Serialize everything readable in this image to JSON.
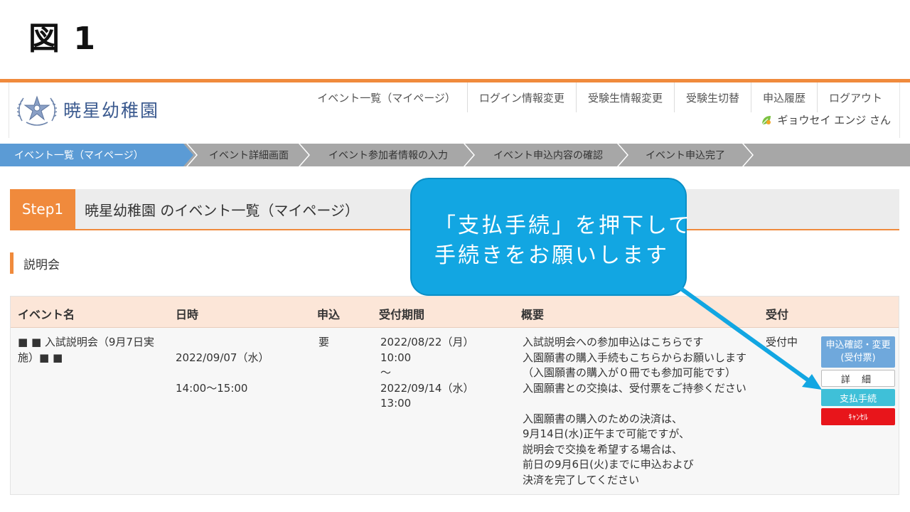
{
  "figure_label": "図 1",
  "logo": {
    "text": "暁星幼稚園"
  },
  "nav": [
    "イベント一覧（マイページ）",
    "ログイン情報変更",
    "受験生情報変更",
    "受験生切替",
    "申込履歴",
    "ログアウト"
  ],
  "user": {
    "name": "ギョウセイ エンジ さん"
  },
  "steps": [
    "イベント一覧（マイページ）",
    "イベント詳細画面",
    "イベント参加者情報の入力",
    "イベント申込内容の確認",
    "イベント申込完了"
  ],
  "step_header": {
    "badge": "Step1",
    "title": "暁星幼稚園 のイベント一覧（マイページ）"
  },
  "section": {
    "title": "説明会"
  },
  "table": {
    "headers": [
      "イベント名",
      "日時",
      "申込",
      "受付期間",
      "概要",
      "受付"
    ],
    "row": {
      "name": "■ ■ 入試説明会（9月7日実施）■ ■",
      "date_line1": "2022/09/07（水）",
      "date_line2": "14:00〜15:00",
      "required": "要",
      "period": [
        "2022/08/22（月）",
        "10:00",
        "〜",
        "2022/09/14（水）",
        "13:00"
      ],
      "summary": [
        "入試説明会への参加申込はこちらです",
        "入園願書の購入手続もこちらからお願いします",
        "（入園願書の購入が０冊でも参加可能です）",
        "入園願書との交換は、受付票をご持参ください",
        "",
        "入園願書の購入のための決済は、",
        "9月14日(水)正午まで可能ですが、",
        "説明会で交換を希望する場合は、",
        "前日の9月6日(火)までに申込および",
        "決済を完了してください"
      ],
      "status": "受付中",
      "buttons": {
        "confirm_line1": "申込確認・変更",
        "confirm_line2": "(受付票)",
        "detail": "詳 細",
        "pay": "支払手続",
        "cancel": "ｷｬﾝｾﾙ"
      }
    }
  },
  "callout": {
    "line1": "「支払手続」を押下して",
    "line2": "手続きをお願いします"
  },
  "colors": {
    "accent_orange": "#f08a3c",
    "step_active": "#5b9bd5",
    "callout_blue": "#12a6e2",
    "pay_button": "#3fc0d8",
    "cancel_button": "#e8151b"
  }
}
